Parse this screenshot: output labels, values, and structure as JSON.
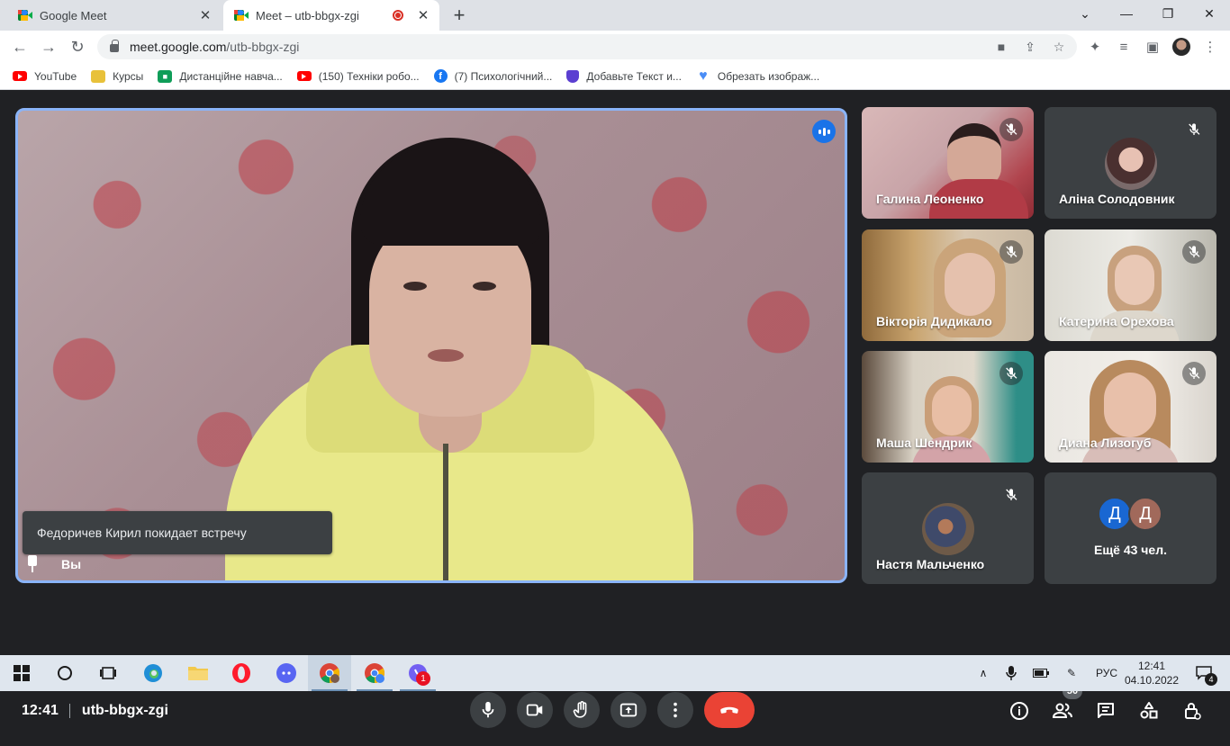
{
  "browser": {
    "tabs": [
      {
        "title": "Google Meet",
        "active": false
      },
      {
        "title": "Meet – utb-bbgx-zgi",
        "active": true,
        "recording": true
      }
    ],
    "url_host": "meet.google.com",
    "url_path": "/utb-bbgx-zgi",
    "bookmarks": [
      {
        "label": "YouTube",
        "icon": "youtube-icon"
      },
      {
        "label": "Курсы",
        "icon": "folder-icon"
      },
      {
        "label": "Дистанційне навча...",
        "icon": "classroom-icon"
      },
      {
        "label": "(150) Техніки робо...",
        "icon": "youtube-icon"
      },
      {
        "label": "(7) Психологічний...",
        "icon": "facebook-icon"
      },
      {
        "label": "Добавьте Текст и...",
        "icon": "shield-icon"
      },
      {
        "label": "Обрезать изображ...",
        "icon": "heart-icon"
      }
    ]
  },
  "meet": {
    "main_tile": {
      "self_label": "Вы",
      "toast": "Федоричев Кирил покидает встречу"
    },
    "participants": [
      {
        "name": "Галина Леоненко",
        "muted": true,
        "video": true
      },
      {
        "name": "Аліна Солодовник",
        "muted": true,
        "video": false
      },
      {
        "name": "Вікторія Дидикало",
        "muted": true,
        "video": true
      },
      {
        "name": "Катерина Орехова",
        "muted": true,
        "video": true
      },
      {
        "name": "Маша Шендрик",
        "muted": true,
        "video": true
      },
      {
        "name": "Диана Лизогуб",
        "muted": true,
        "video": true
      },
      {
        "name": "Настя Мальченко",
        "muted": true,
        "video": false
      }
    ],
    "more_tile": {
      "avatars": [
        {
          "letter": "Д",
          "color": "#1967d2"
        },
        {
          "letter": "Д",
          "color": "#a1695b"
        }
      ],
      "label": "Ещё 43 чел."
    },
    "bottom_bar": {
      "time": "12:41",
      "meeting_code": "utb-bbgx-zgi",
      "participants_count": "50"
    },
    "colors": {
      "accent": "#8ab4f8",
      "end_call": "#ea4335",
      "background": "#202124"
    }
  },
  "taskbar": {
    "language": "РУС",
    "time": "12:41",
    "date": "04.10.2022",
    "notification_count": "4",
    "viber_badge": "1"
  }
}
